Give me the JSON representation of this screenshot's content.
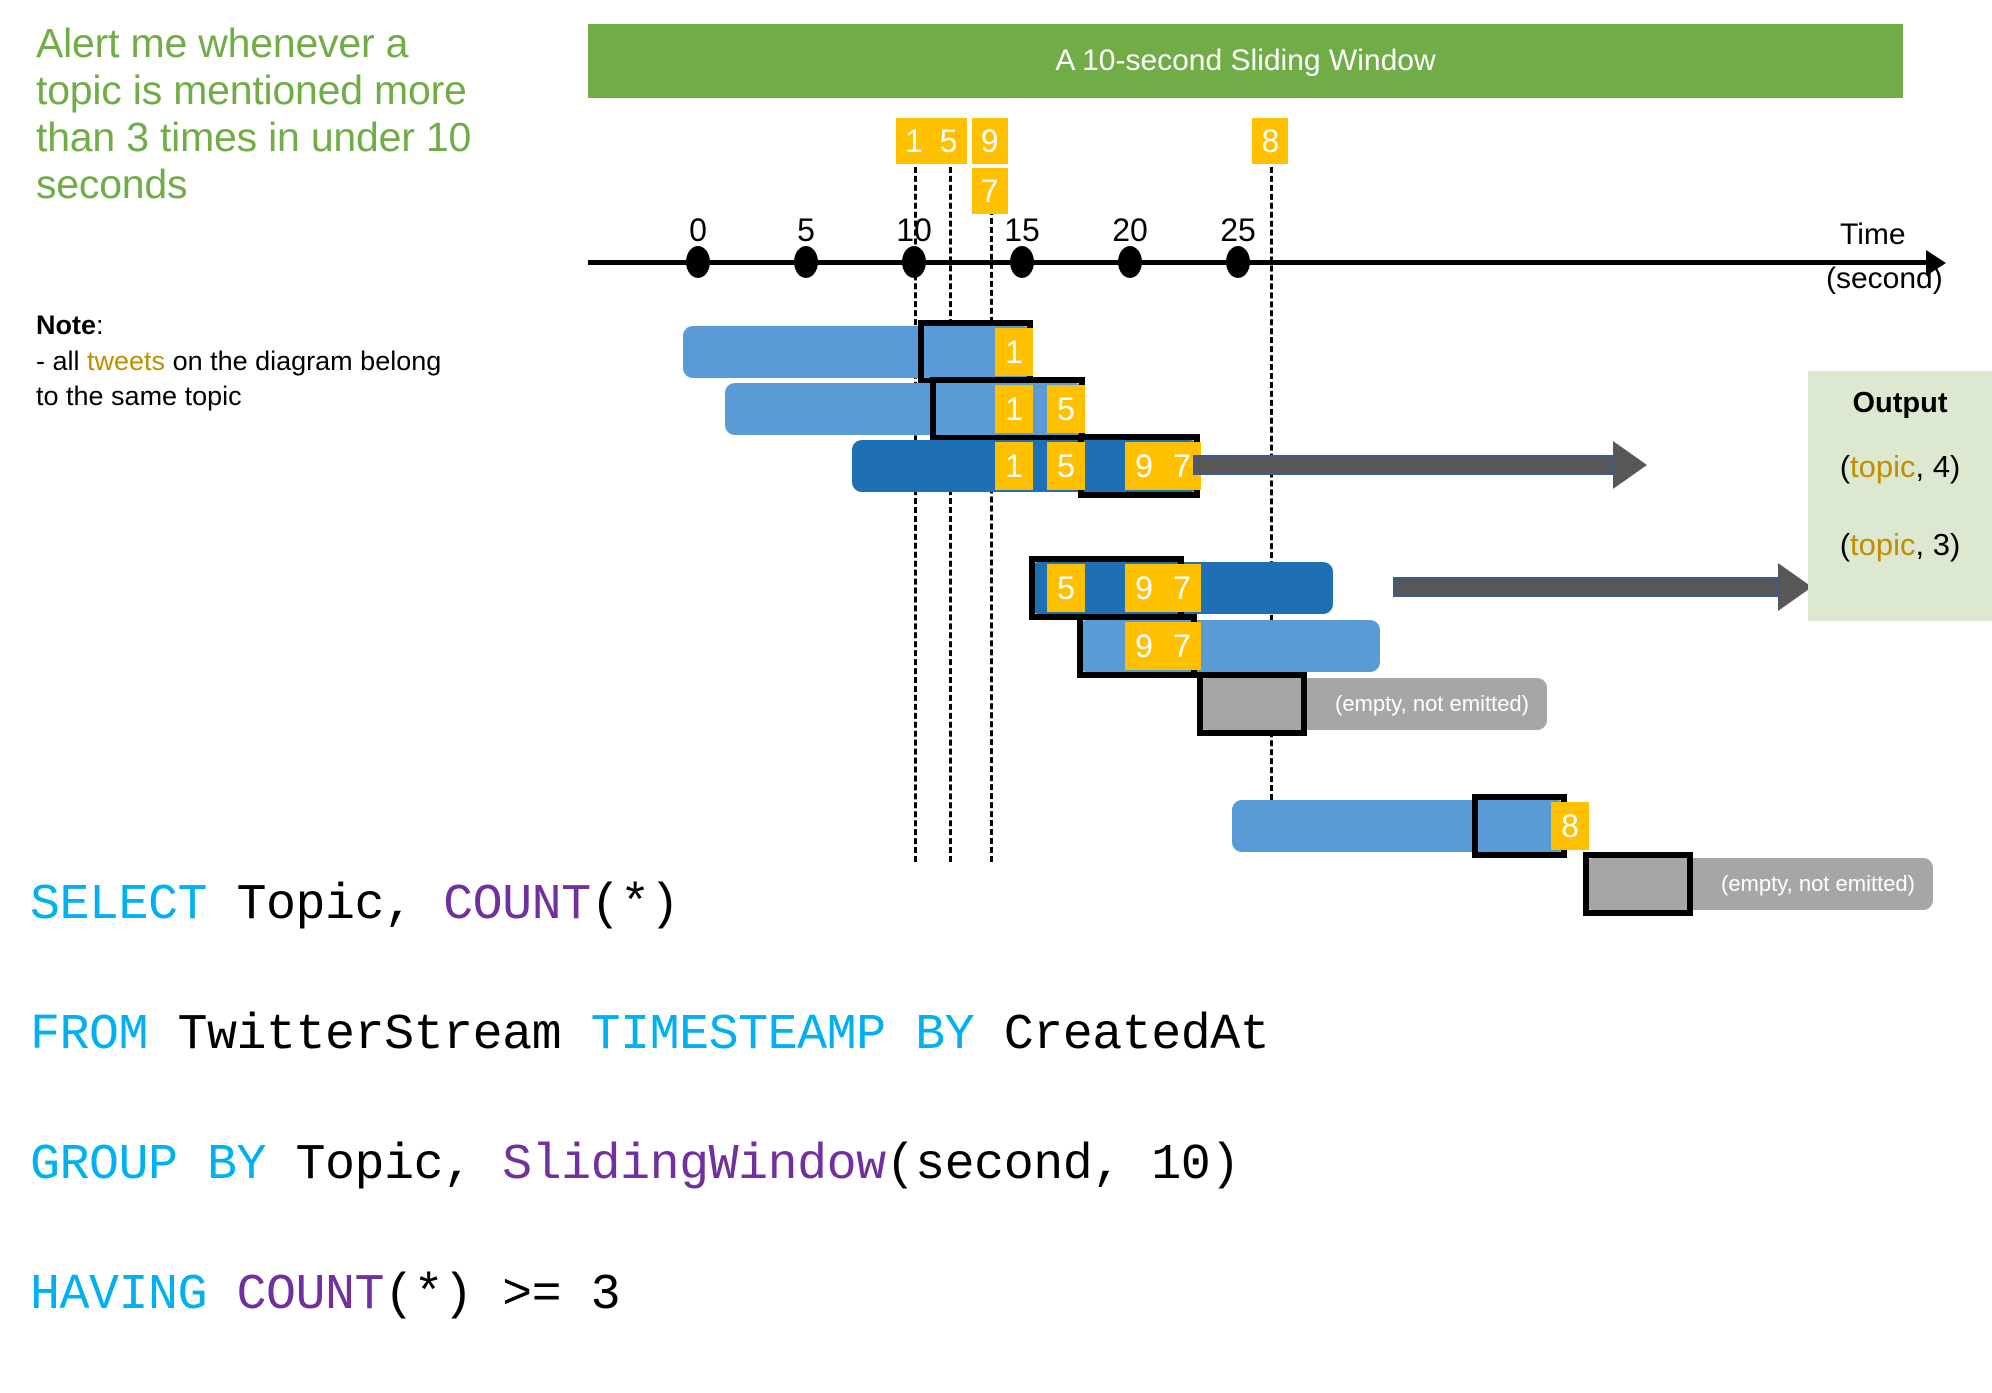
{
  "headline": "Alert me whenever a topic is mentioned more than 3 times in under 10 seconds",
  "note": {
    "label": "Note",
    "colon": ":",
    "line_prefix": "- all ",
    "highlight": "tweets",
    "line_suffix": " on the diagram belong to the same topic"
  },
  "header": {
    "title": "A 10-second Sliding Window"
  },
  "axis": {
    "ticks": [
      "0",
      "5",
      "10",
      "15",
      "20",
      "25"
    ],
    "time_label": "Time",
    "unit_label": "(second)"
  },
  "top_tweets": [
    {
      "value": "1",
      "time": 10
    },
    {
      "value": "5",
      "time": 11.6
    },
    {
      "value": "9",
      "time": 13.5
    },
    {
      "value": "7",
      "time": 13.5
    },
    {
      "value": "8",
      "time": 26.5
    }
  ],
  "dashed_lines": [
    10,
    11.6,
    13.5,
    26.5
  ],
  "windows": [
    {
      "shade": "light",
      "tweets": [
        "1"
      ],
      "emitted": false,
      "label": ""
    },
    {
      "shade": "light",
      "tweets": [
        "1",
        "5"
      ],
      "emitted": false,
      "label": ""
    },
    {
      "shade": "dark",
      "tweets": [
        "1",
        "5",
        "9",
        "7"
      ],
      "emitted": true,
      "label": ""
    },
    {
      "shade": "dark",
      "tweets": [
        "5",
        "9",
        "7"
      ],
      "emitted": true,
      "label": ""
    },
    {
      "shade": "light",
      "tweets": [
        "9",
        "7"
      ],
      "emitted": false,
      "label": ""
    },
    {
      "shade": "gray",
      "tweets": [],
      "emitted": false,
      "label": "(empty, not emitted)"
    },
    {
      "shade": "light",
      "tweets": [
        "8"
      ],
      "emitted": false,
      "label": ""
    },
    {
      "shade": "gray",
      "tweets": [],
      "emitted": false,
      "label": "(empty, not emitted)"
    }
  ],
  "output": {
    "title": "Output",
    "rows": [
      {
        "open": "(",
        "topic": "topic",
        "rest": ", 4)"
      },
      {
        "open": "(",
        "topic": "topic",
        "rest": ", 3)"
      }
    ]
  },
  "sql": {
    "line1_kw1": "SELECT",
    "line1_mid": " Topic, ",
    "line1_kw2": "COUNT",
    "line1_end": "(*)",
    "line2_kw1": "FROM",
    "line2_mid": " TwitterStream ",
    "line2_kw2": "TIMESTEAMP BY",
    "line2_end": " CreatedAt",
    "line3_kw1": "GROUP BY",
    "line3_mid": " Topic, ",
    "line3_kw2": "SlidingWindow",
    "line3_end": "(second, 10)",
    "line4_kw1": "HAVING",
    "line4_kw2": " COUNT",
    "line4_end": "(*) >= 3"
  },
  "colors": {
    "green": "#70ad47",
    "amber": "#ffc000",
    "light_blue": "#5b9bd5",
    "dark_blue": "#1f6fb4",
    "gray": "#a6a6a6",
    "panel_green": "#dce8d0",
    "sql_blue": "#00b0f0",
    "sql_purple": "#7030a0",
    "topic_gold": "#bf8f00"
  }
}
